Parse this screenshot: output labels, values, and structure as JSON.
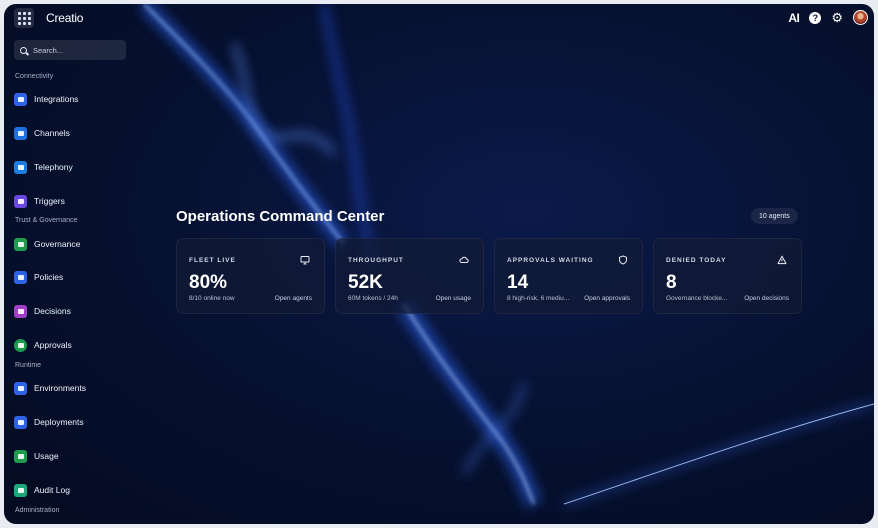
{
  "topbar": {
    "logo": "Creatio",
    "ai_label": "AI",
    "help_glyph": "?",
    "icons": [
      "apps-grid-icon",
      "ai-icon",
      "help-icon",
      "gear-icon",
      "avatar"
    ]
  },
  "search": {
    "placeholder": "Search..."
  },
  "sidebar": {
    "sections": [
      {
        "title": "Connectivity"
      },
      {
        "title": "Trust & Governance"
      },
      {
        "title": "Runtime"
      },
      {
        "title": "Administration"
      }
    ],
    "items": [
      {
        "label": "Integrations",
        "color": "#2f63e6"
      },
      {
        "label": "Channels",
        "color": "#1f6fe0"
      },
      {
        "label": "Telephony",
        "color": "#1d7cdf"
      },
      {
        "label": "Triggers",
        "color": "#6a48e0"
      },
      {
        "label": "Governance",
        "color": "#1e9b4e"
      },
      {
        "label": "Policies",
        "color": "#2f63e6"
      },
      {
        "label": "Decisions",
        "color": "#a13fc6"
      },
      {
        "label": "Approvals",
        "color": "#1e9b4e"
      },
      {
        "label": "Environments",
        "color": "#2f63e6"
      },
      {
        "label": "Deployments",
        "color": "#2f63e6"
      },
      {
        "label": "Usage",
        "color": "#1e9b4e"
      },
      {
        "label": "Audit Log",
        "color": "#1ea77a"
      }
    ]
  },
  "main": {
    "title": "Operations Command Center",
    "agents_badge": "10 agents",
    "cards": [
      {
        "label": "FLEET LIVE",
        "icon": "monitor-icon",
        "value": "80%",
        "sub": "8/10 online now",
        "link": "Open agents"
      },
      {
        "label": "THROUGHPUT",
        "icon": "cloud-icon",
        "value": "52K",
        "sub": "60M tokens / 24h",
        "link": "Open usage"
      },
      {
        "label": "APPROVALS WAITING",
        "icon": "shield-icon",
        "value": "14",
        "sub": "8 high-risk, 6 mediu...",
        "link": "Open approvals"
      },
      {
        "label": "DENIED TODAY",
        "icon": "warning-icon",
        "value": "8",
        "sub": "Governance blocke...",
        "link": "Open decisions"
      }
    ]
  }
}
